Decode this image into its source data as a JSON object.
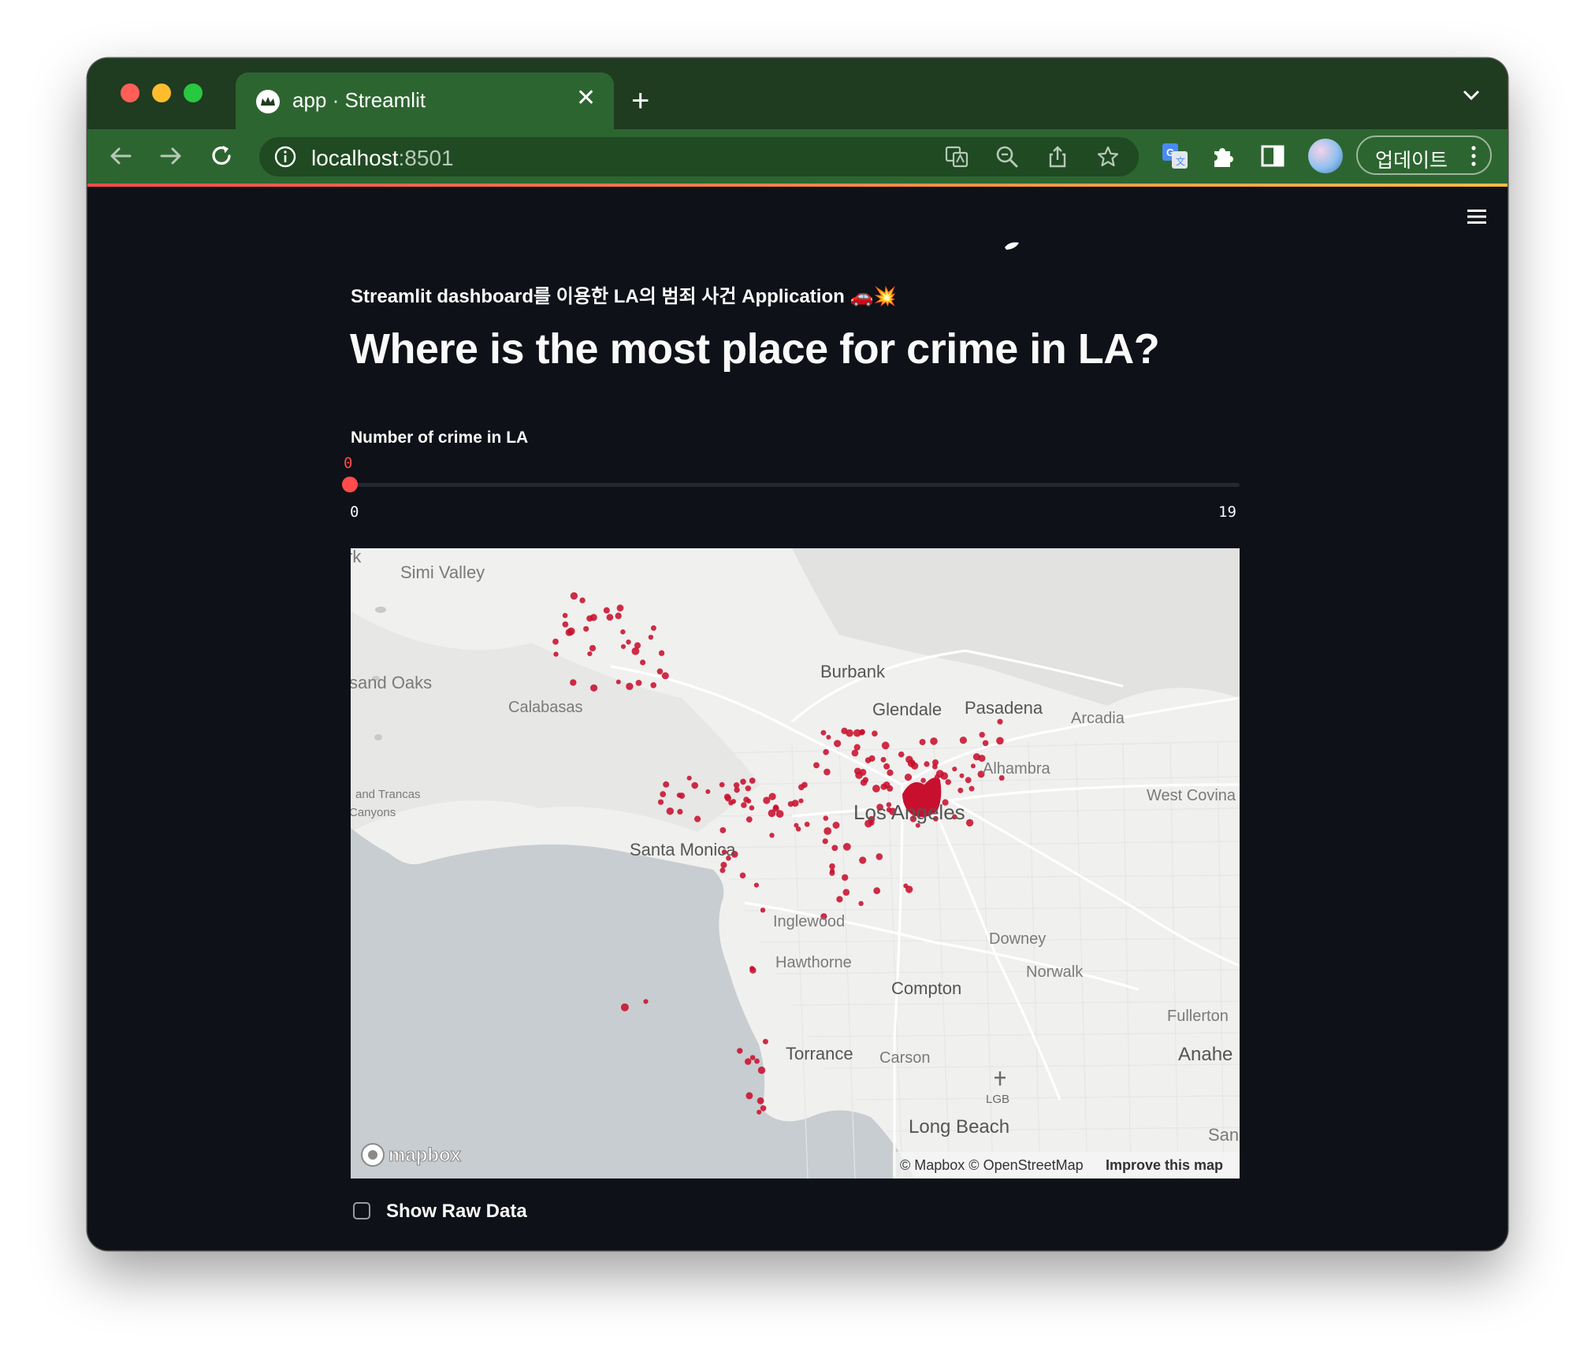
{
  "browser": {
    "tab_title": "app · Streamlit",
    "url_host": "localhost",
    "url_port": ":8501",
    "update_button": "업데이트",
    "traffic_colors": [
      "#ff5f57",
      "#febc2e",
      "#28c840"
    ]
  },
  "app": {
    "subtitle": "Streamlit dashboard를 이용한 LA의 범죄 사건 Application 🚗💥",
    "title": "Where is the most place for crime in LA?",
    "slider": {
      "label": "Number of crime in LA",
      "value": "0",
      "min": "0",
      "max": "19"
    },
    "checkbox_label": "Show Raw Data",
    "accent_color": "#ff4b4b"
  },
  "map": {
    "provider_logo": "mapbox",
    "attribution": "© Mapbox © OpenStreetMap",
    "improve_link": "Improve this map",
    "airport_code": "LGB",
    "place_labels": {
      "simi_valley": "Simi Valley",
      "rk": "rk",
      "thousand_oaks": "sand Oaks",
      "calabasas": "Calabasas",
      "burbank": "Burbank",
      "glendale": "Glendale",
      "pasadena": "Pasadena",
      "arcadia": "Arcadia",
      "alhambra": "Alhambra",
      "west_covina": "West Covina",
      "trancas_1": "and Trancas",
      "trancas_2": "Canyons",
      "los_angeles": "Los Angeles",
      "santa_monica": "Santa Monica",
      "inglewood": "Inglewood",
      "hawthorne": "Hawthorne",
      "downey": "Downey",
      "norwalk": "Norwalk",
      "compton": "Compton",
      "fullerton": "Fullerton",
      "anaheim": "Anahe",
      "torrance": "Torrance",
      "carson": "Carson",
      "long_beach": "Long Beach",
      "santa_ana": "San"
    },
    "point_color": "#c8102e"
  }
}
